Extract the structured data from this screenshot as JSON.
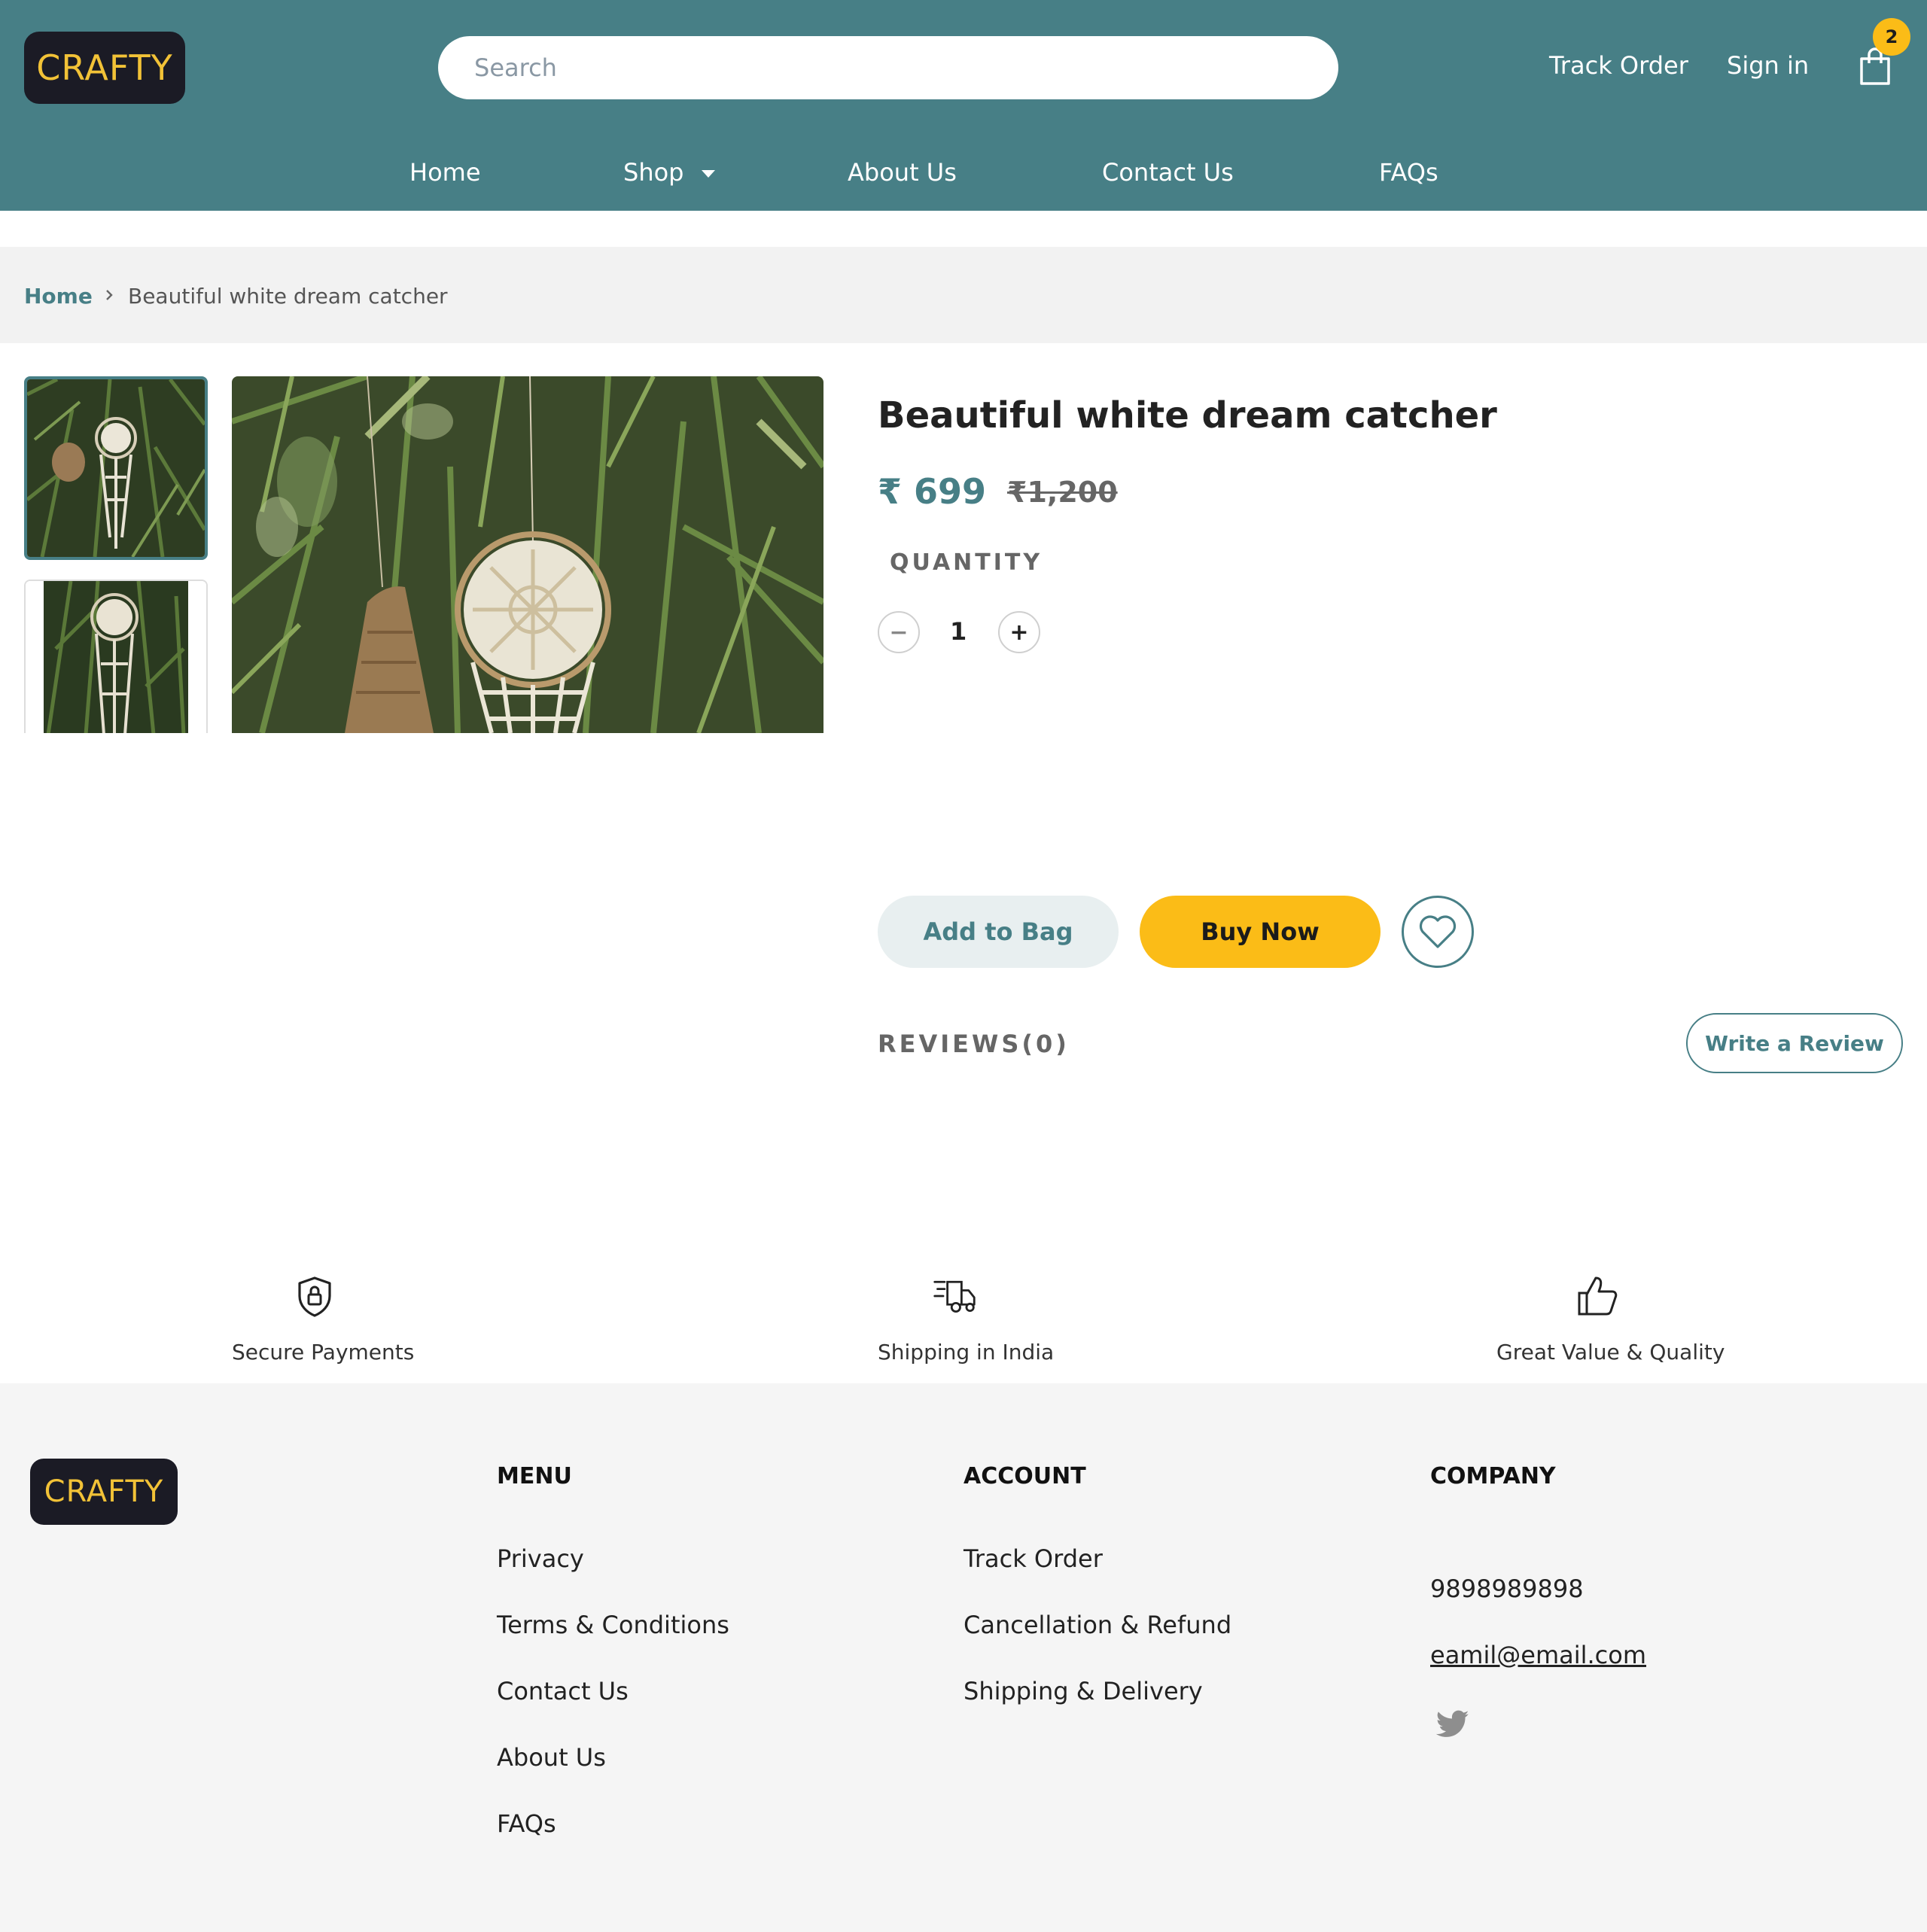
{
  "header": {
    "logo_text": "CRAFTY",
    "search_placeholder": "Search",
    "track_order": "Track Order",
    "sign_in": "Sign in",
    "cart_count": "2",
    "nav": [
      "Home",
      "Shop",
      "About Us",
      "Contact Us",
      "FAQs"
    ]
  },
  "breadcrumb": {
    "home": "Home",
    "current": "Beautiful white dream catcher"
  },
  "product": {
    "title": "Beautiful white dream catcher",
    "price": "₹ 699",
    "mrp": "₹1,200",
    "quantity_label": "QUANTITY",
    "quantity": "1",
    "minus": "−",
    "plus": "+",
    "add_to_bag": "Add to Bag",
    "buy_now": "Buy Now",
    "reviews_label": "REVIEWS(0)",
    "write_review": "Write a Review"
  },
  "features": [
    "Secure Payments",
    "Shipping in India",
    "Great Value & Quality"
  ],
  "footer": {
    "logo_text": "CRAFTY",
    "menu": {
      "heading": "MENU",
      "links": [
        "Privacy",
        "Terms & Conditions",
        "Contact Us",
        "About Us",
        "FAQs"
      ]
    },
    "account": {
      "heading": "ACCOUNT",
      "links": [
        "Track Order",
        "Cancellation & Refund",
        "Shipping & Delivery"
      ]
    },
    "company": {
      "heading": "COMPANY",
      "phone": "9898989898",
      "email": "eamil@email.com"
    }
  },
  "colors": {
    "brand": "#477f86",
    "accent": "#fbbc17",
    "logo_bg": "#1b1b25",
    "logo_text": "#f2c237"
  },
  "icons": {
    "cart": "shopping-bag-icon",
    "wishlist": "heart-icon",
    "secure": "shield-lock-icon",
    "shipping": "delivery-truck-icon",
    "quality": "thumbs-up-icon",
    "social": "twitter-icon"
  }
}
